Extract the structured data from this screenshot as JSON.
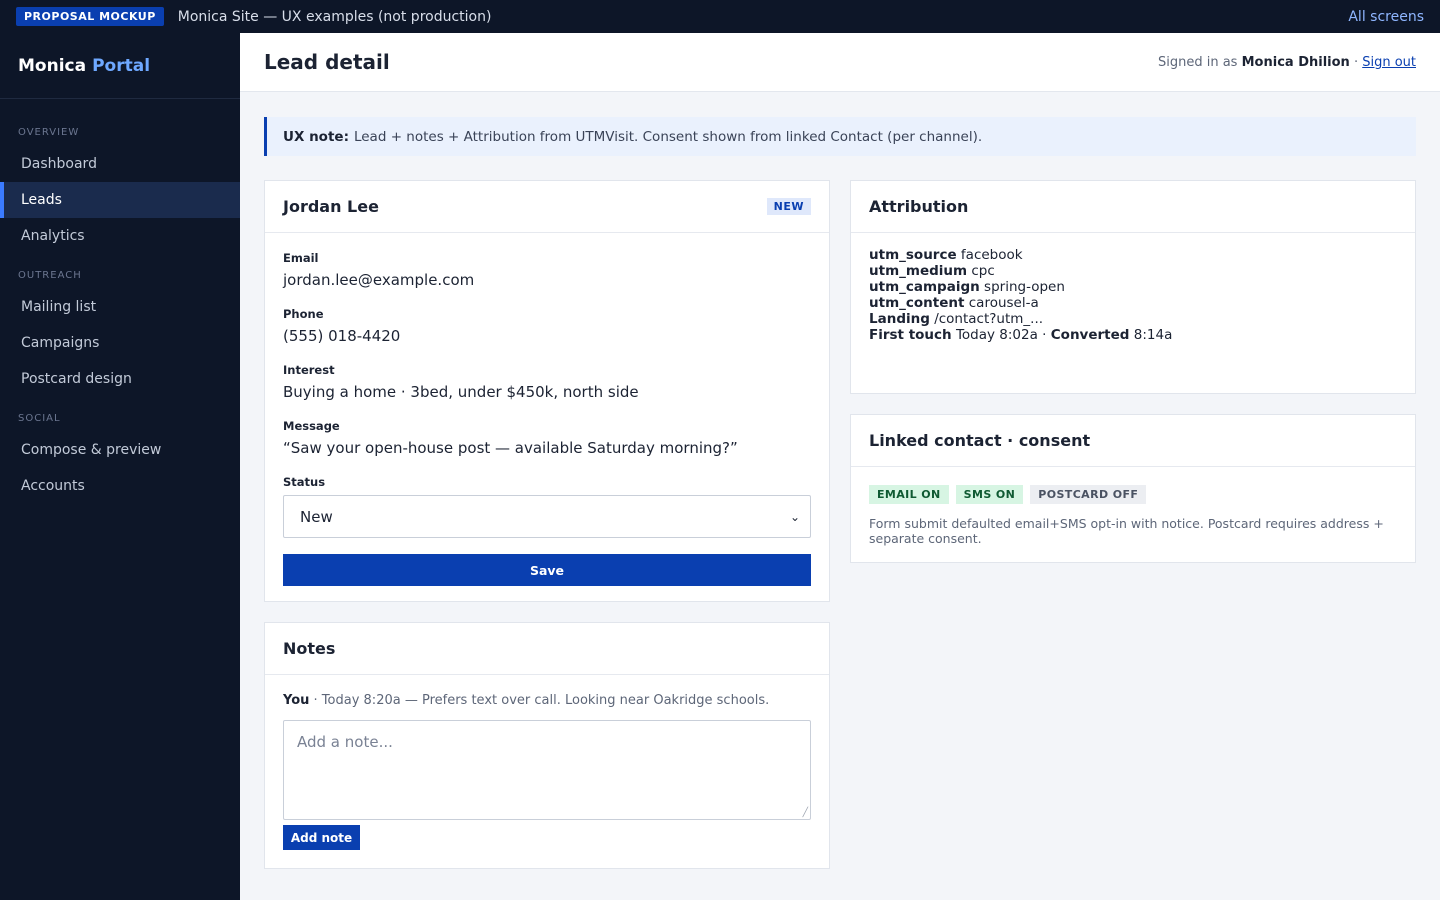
{
  "topbar": {
    "badge": "PROPOSAL MOCKUP",
    "title": "Monica Site — UX examples (not production)",
    "all_screens": "All screens"
  },
  "brand": {
    "name": "Monica",
    "accent": "Portal"
  },
  "sidebar": {
    "sections": [
      {
        "label": "OVERVIEW",
        "items": [
          "Dashboard",
          "Leads",
          "Analytics"
        ]
      },
      {
        "label": "OUTREACH",
        "items": [
          "Mailing list",
          "Campaigns",
          "Postcard design"
        ]
      },
      {
        "label": "SOCIAL",
        "items": [
          "Compose & preview",
          "Accounts"
        ]
      }
    ],
    "active": "Leads"
  },
  "header": {
    "title": "Lead detail",
    "signed_in_prefix": "Signed in as",
    "user": "Monica Dhilion",
    "separator": "·",
    "sign_out": "Sign out"
  },
  "ux_note": {
    "label": "UX note:",
    "text": "Lead + notes + Attribution from UTMVisit. Consent shown from linked Contact (per channel)."
  },
  "lead": {
    "name": "Jordan Lee",
    "badge": "NEW",
    "email_label": "Email",
    "email": "jordan.lee@example.com",
    "phone_label": "Phone",
    "phone": "(555) 018-4420",
    "interest_label": "Interest",
    "interest": "Buying a home · 3bed, under $450k, north side",
    "message_label": "Message",
    "message": "“Saw your open-house post — available Saturday morning?”",
    "status_label": "Status",
    "status": "New",
    "save": "Save"
  },
  "notes": {
    "title": "Notes",
    "author": "You",
    "meta": "· Today 8:20a — Prefers text over call. Looking near Oakridge schools.",
    "placeholder": "Add a note...",
    "add": "Add note"
  },
  "attribution": {
    "title": "Attribution",
    "rows": [
      {
        "k": "utm_source",
        "v": "facebook"
      },
      {
        "k": "utm_medium",
        "v": "cpc"
      },
      {
        "k": "utm_campaign",
        "v": "spring-open"
      },
      {
        "k": "utm_content",
        "v": "carousel-a"
      },
      {
        "k": "Landing",
        "v": "/contact?utm_..."
      }
    ],
    "first_touch_label": "First touch",
    "first_touch": "Today 8:02a ·",
    "converted_label": "Converted",
    "converted": "8:14a"
  },
  "consent": {
    "title": "Linked contact · consent",
    "chips": [
      {
        "label": "EMAIL ON",
        "state": "on"
      },
      {
        "label": "SMS ON",
        "state": "on"
      },
      {
        "label": "POSTCARD OFF",
        "state": "off"
      }
    ],
    "note": "Form submit defaulted email+SMS opt-in with notice. Postcard requires address + separate consent."
  },
  "colors": {
    "accent": "#0a3fb0",
    "sidebar_bg": "#0d1628",
    "on_chip": "#d7f5e3"
  }
}
